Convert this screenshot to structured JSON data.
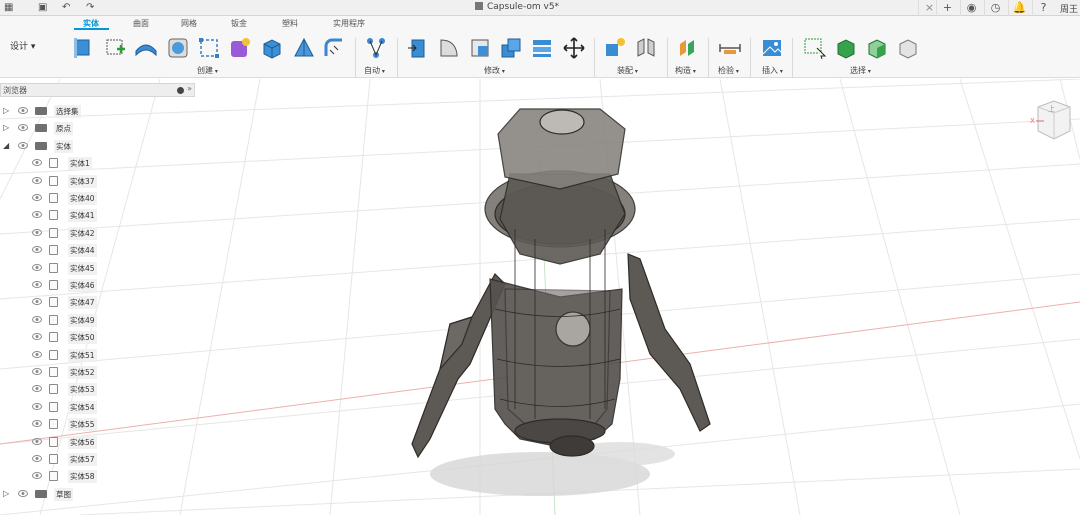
{
  "window": {
    "title": "Capsule-om v5*",
    "user": "周王"
  },
  "ribbon": {
    "workspace": "设计 ▾",
    "tabs": [
      "实体",
      "曲面",
      "网格",
      "钣金",
      "塑料",
      "实用程序"
    ],
    "active_tab": "实体",
    "groups": [
      {
        "label": "创建"
      },
      {
        "label": "自动"
      },
      {
        "label": "修改"
      },
      {
        "label": "装配"
      },
      {
        "label": "构造"
      },
      {
        "label": "检验"
      },
      {
        "label": "插入"
      },
      {
        "label": "选择"
      }
    ]
  },
  "browser": {
    "header": "浏览器",
    "nodes": [
      {
        "label": "选择集",
        "type": "folder",
        "level": 0
      },
      {
        "label": "原点",
        "type": "folder",
        "level": 0
      },
      {
        "label": "实体",
        "type": "folder",
        "level": 0,
        "expanded": true
      },
      {
        "label": "实体1",
        "type": "body",
        "level": 1
      },
      {
        "label": "实体37",
        "type": "body",
        "level": 1
      },
      {
        "label": "实体40",
        "type": "body",
        "level": 1
      },
      {
        "label": "实体41",
        "type": "body",
        "level": 1
      },
      {
        "label": "实体42",
        "type": "body",
        "level": 1
      },
      {
        "label": "实体44",
        "type": "body",
        "level": 1
      },
      {
        "label": "实体45",
        "type": "body",
        "level": 1
      },
      {
        "label": "实体46",
        "type": "body",
        "level": 1
      },
      {
        "label": "实体47",
        "type": "body",
        "level": 1
      },
      {
        "label": "实体49",
        "type": "body",
        "level": 1
      },
      {
        "label": "实体50",
        "type": "body",
        "level": 1
      },
      {
        "label": "实体51",
        "type": "body",
        "level": 1
      },
      {
        "label": "实体52",
        "type": "body",
        "level": 1
      },
      {
        "label": "实体53",
        "type": "body",
        "level": 1
      },
      {
        "label": "实体54",
        "type": "body",
        "level": 1
      },
      {
        "label": "实体55",
        "type": "body",
        "level": 1
      },
      {
        "label": "实体56",
        "type": "body",
        "level": 1
      },
      {
        "label": "实体57",
        "type": "body",
        "level": 1
      },
      {
        "label": "实体58",
        "type": "body",
        "level": 1
      },
      {
        "label": "草图",
        "type": "folder",
        "level": 0
      }
    ]
  },
  "viewcube": {
    "face": "上",
    "axis_x": "X"
  },
  "colors": {
    "accent": "#0696d7",
    "grid": "#e3e3e3",
    "axis_red": "#e7a0a0",
    "axis_green": "#a8d6a8",
    "model": "#4a4744"
  }
}
